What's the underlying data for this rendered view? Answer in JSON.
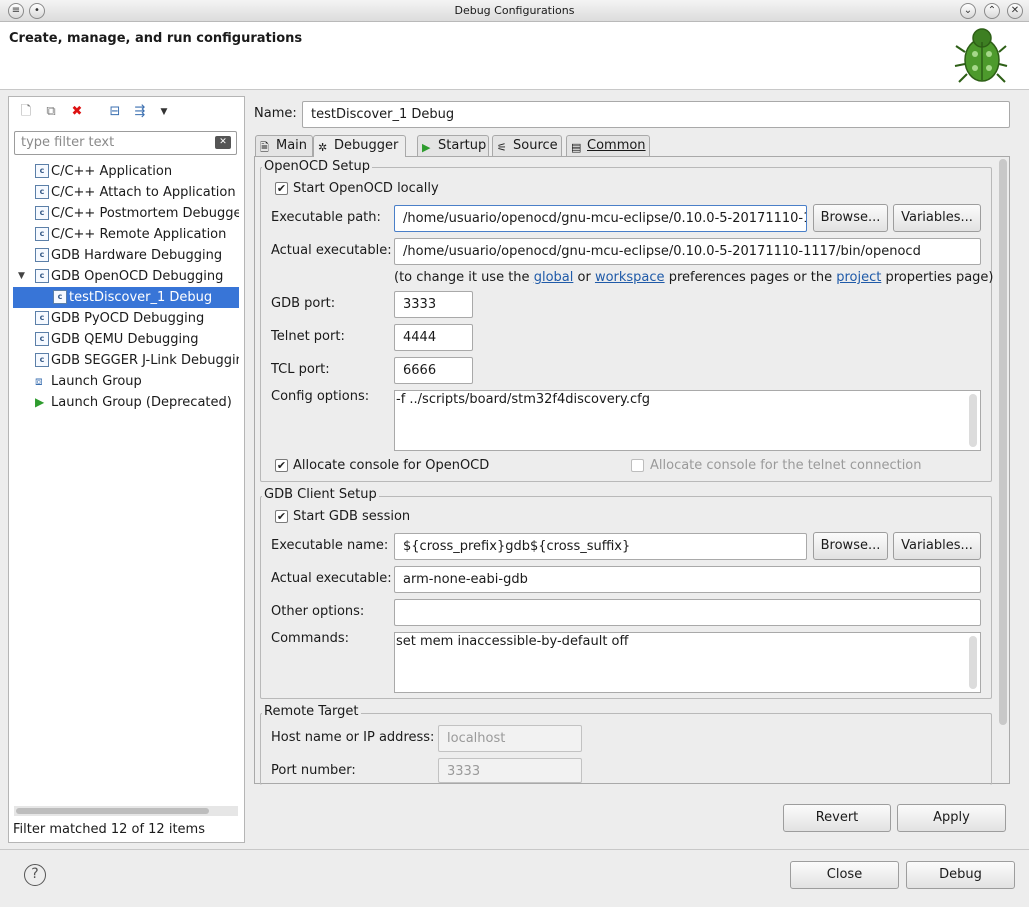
{
  "window": {
    "title": "Debug Configurations"
  },
  "header": {
    "title": "Create, manage, and run configurations"
  },
  "filter": {
    "placeholder": "type filter text"
  },
  "tree": {
    "items": [
      {
        "label": "C/C++ Application"
      },
      {
        "label": "C/C++ Attach to Application"
      },
      {
        "label": "C/C++ Postmortem Debugger"
      },
      {
        "label": "C/C++ Remote Application"
      },
      {
        "label": "GDB Hardware Debugging"
      },
      {
        "label": "GDB OpenOCD Debugging"
      },
      {
        "label": "testDiscover_1 Debug"
      },
      {
        "label": "GDB PyOCD Debugging"
      },
      {
        "label": "GDB QEMU Debugging"
      },
      {
        "label": "GDB SEGGER J-Link Debugging"
      },
      {
        "label": "Launch Group"
      },
      {
        "label": "Launch Group (Deprecated)"
      }
    ]
  },
  "status": {
    "filter_matched": "Filter matched 12 of 12 items"
  },
  "name": {
    "label": "Name:",
    "value": "testDiscover_1 Debug"
  },
  "tabs": [
    {
      "label": "Main",
      "icon": "main-tab-icon"
    },
    {
      "label": "Debugger",
      "icon": "bug-icon"
    },
    {
      "label": "Startup",
      "icon": "play-icon"
    },
    {
      "label": "Source",
      "icon": "source-icon"
    },
    {
      "label": "Common",
      "icon": "common-tab-icon"
    }
  ],
  "openocd": {
    "group_title": "OpenOCD Setup",
    "start_locally": "Start OpenOCD locally",
    "exec_path_label": "Executable path:",
    "exec_path_value": "/home/usuario/openocd/gnu-mcu-eclipse/0.10.0-5-20171110-1",
    "browse": "Browse...",
    "variables": "Variables...",
    "actual_exec_label": "Actual executable:",
    "actual_exec_value": "/home/usuario/openocd/gnu-mcu-eclipse/0.10.0-5-20171110-1117/bin/openocd",
    "hint_prefix": "(to change it use the",
    "hint_global": "global",
    "hint_or": "or",
    "hint_workspace": "workspace",
    "hint_mid": "preferences pages or the",
    "hint_project": "project",
    "hint_suffix": "properties page)",
    "gdb_port_label": "GDB port:",
    "gdb_port_value": "3333",
    "telnet_port_label": "Telnet port:",
    "telnet_port_value": "4444",
    "tcl_port_label": "TCL port:",
    "tcl_port_value": "6666",
    "config_label": "Config options:",
    "config_value": "-f ../scripts/board/stm32f4discovery.cfg",
    "alloc_console": "Allocate console for OpenOCD",
    "alloc_telnet": "Allocate console for the telnet connection"
  },
  "gdbclient": {
    "group_title": "GDB Client Setup",
    "start_session": "Start GDB session",
    "exec_name_label": "Executable name:",
    "exec_name_value": "${cross_prefix}gdb${cross_suffix}",
    "browse": "Browse...",
    "variables": "Variables...",
    "actual_exec_label": "Actual executable:",
    "actual_exec_value": "arm-none-eabi-gdb",
    "other_label": "Other options:",
    "other_value": "",
    "commands_label": "Commands:",
    "commands_value": "set mem inaccessible-by-default off"
  },
  "remote": {
    "group_title": "Remote Target",
    "host_label": "Host name or IP address:",
    "host_value": "localhost",
    "port_label": "Port number:",
    "port_value": "3333"
  },
  "buttons": {
    "revert": "Revert",
    "apply": "Apply",
    "close": "Close",
    "debug": "Debug"
  }
}
